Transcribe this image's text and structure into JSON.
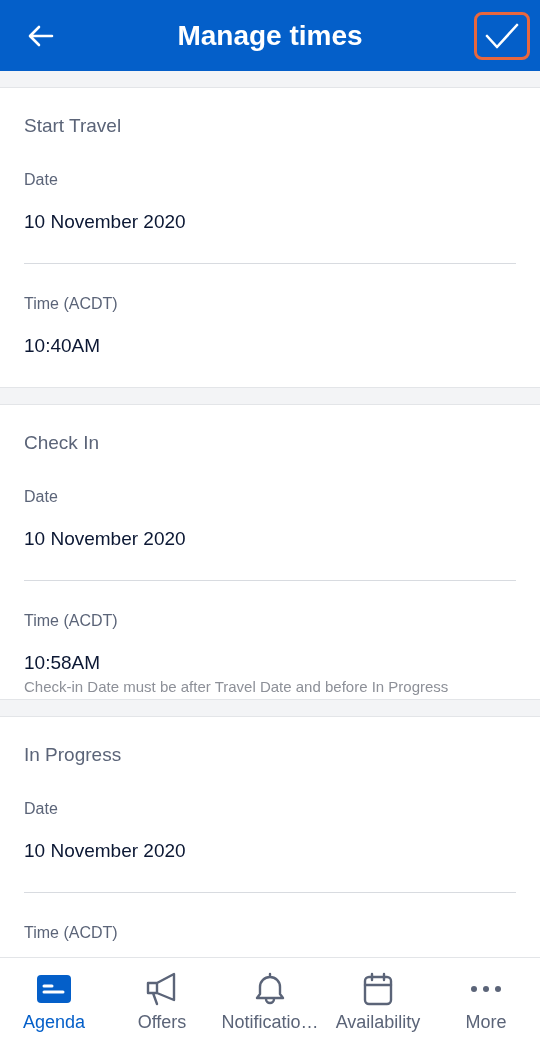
{
  "header": {
    "title": "Manage times",
    "back": {
      "kind": "back"
    },
    "confirm": {
      "kind": "check",
      "highlighted": true
    }
  },
  "sections": [
    {
      "title": "Start Travel",
      "fields": [
        {
          "label": "Date",
          "value": "10 November 2020"
        },
        {
          "label": "Time (ACDT)",
          "value": "10:40AM"
        }
      ]
    },
    {
      "title": "Check In",
      "fields": [
        {
          "label": "Date",
          "value": "10 November 2020"
        },
        {
          "label": "Time (ACDT)",
          "value": "10:58AM",
          "error": "Check-in Date must be after Travel Date and before In Progress"
        }
      ]
    },
    {
      "title": "In Progress",
      "fields": [
        {
          "label": "Date",
          "value": "10 November 2020"
        },
        {
          "label": "Time (ACDT)"
        }
      ]
    }
  ],
  "nav": [
    {
      "label": "Agenda",
      "kind": "agenda",
      "selected": true
    },
    {
      "label": "Offers",
      "kind": "megaphone",
      "selected": false
    },
    {
      "label": "Notificatio…",
      "kind": "bell",
      "selected": false
    },
    {
      "label": "Availability",
      "kind": "calendar",
      "selected": false
    },
    {
      "label": "More",
      "kind": "more",
      "selected": false
    }
  ]
}
